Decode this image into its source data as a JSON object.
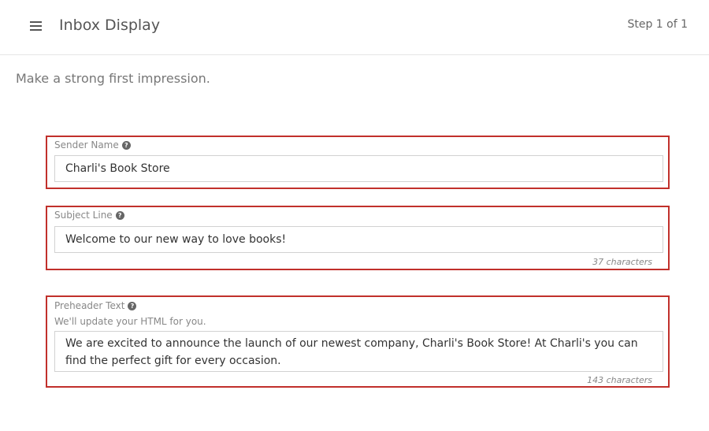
{
  "header": {
    "title": "Inbox Display",
    "step": "Step 1 of 1"
  },
  "intro": "Make a strong first impression.",
  "fields": {
    "sender": {
      "label": "Sender Name",
      "value": "Charli's Book Store"
    },
    "subject": {
      "label": "Subject Line",
      "value": "Welcome to our new way to love books!",
      "count": "37 characters"
    },
    "preheader": {
      "label": "Preheader Text",
      "hint": "We'll update your HTML for you.",
      "value": "We are excited to announce the launch of our newest company, Charli's Book Store! At Charli's you can find the perfect gift for every occasion.",
      "count": "143 characters"
    }
  },
  "icons": {
    "menu": "hamburger-icon",
    "help": "question-circle-icon"
  },
  "colors": {
    "highlight_border": "#c1302b"
  }
}
